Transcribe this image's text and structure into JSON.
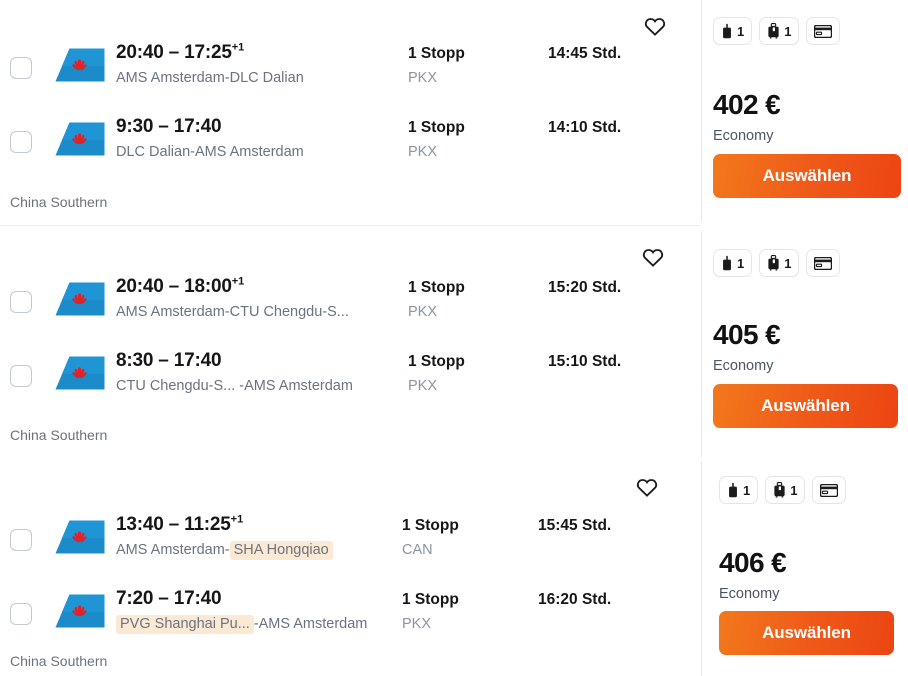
{
  "currency_symbol": "€",
  "accent_color": "#ef5a19",
  "highlight_color": "#fce9d4",
  "results": [
    {
      "airline": "China Southern",
      "price": "402 €",
      "cabin": "Economy",
      "select_label": "Auswählen",
      "favorite_icon": "heart-icon",
      "baggage": [
        {
          "icon": "personal-item-icon",
          "count": "1"
        },
        {
          "icon": "cabin-bag-icon",
          "count": "1"
        },
        {
          "icon": "credit-card-icon",
          "count": ""
        }
      ],
      "legs": [
        {
          "time": "20:40 – 17:25",
          "next_day": "+1",
          "origin_text": "AMS Amsterdam-",
          "origin_highlight": "",
          "destination_text": "DLC Dalian",
          "destination_highlight": "",
          "stops": "1 Stopp",
          "stop_codes": "PKX",
          "duration": "14:45 Std."
        },
        {
          "time": "9:30 – 17:40",
          "next_day": "",
          "origin_text": "DLC Dalian-",
          "origin_highlight": "",
          "destination_text": "AMS Amsterdam",
          "destination_highlight": "",
          "stops": "1 Stopp",
          "stop_codes": "PKX",
          "duration": "14:10 Std."
        }
      ]
    },
    {
      "airline": "China Southern",
      "price": "405 €",
      "cabin": "Economy",
      "select_label": "Auswählen",
      "favorite_icon": "heart-icon",
      "baggage": [
        {
          "icon": "personal-item-icon",
          "count": "1"
        },
        {
          "icon": "cabin-bag-icon",
          "count": "1"
        },
        {
          "icon": "credit-card-icon",
          "count": ""
        }
      ],
      "legs": [
        {
          "time": "20:40 – 18:00",
          "next_day": "+1",
          "origin_text": "AMS Amsterdam-",
          "origin_highlight": "",
          "destination_text": "CTU Chengdu-S...",
          "destination_highlight": "",
          "stops": "1 Stopp",
          "stop_codes": "PKX",
          "duration": "15:20 Std."
        },
        {
          "time": "8:30 – 17:40",
          "next_day": "",
          "origin_text": "CTU Chengdu-S...  -",
          "origin_highlight": "",
          "destination_text": "AMS Amsterdam",
          "destination_highlight": "",
          "stops": "1 Stopp",
          "stop_codes": "PKX",
          "duration": "15:10 Std."
        }
      ]
    },
    {
      "airline": "China Southern",
      "price": "406 €",
      "cabin": "Economy",
      "select_label": "Auswählen",
      "favorite_icon": "heart-icon",
      "baggage": [
        {
          "icon": "personal-item-icon",
          "count": "1"
        },
        {
          "icon": "cabin-bag-icon",
          "count": "1"
        },
        {
          "icon": "credit-card-icon",
          "count": ""
        }
      ],
      "legs": [
        {
          "time": "13:40 – 11:25",
          "next_day": "+1",
          "origin_text": "AMS Amsterdam-",
          "origin_highlight": "",
          "destination_text": "",
          "destination_highlight": "SHA Hongqiao",
          "stops": "1 Stopp",
          "stop_codes": "CAN",
          "duration": "15:45 Std."
        },
        {
          "time": "7:20 – 17:40",
          "next_day": "",
          "origin_text": "",
          "origin_highlight": "PVG Shanghai Pu...",
          "destination_text": "-AMS Amsterdam",
          "destination_highlight": "",
          "stops": "1 Stopp",
          "stop_codes": "PKX",
          "duration": "16:20 Std."
        }
      ]
    }
  ]
}
